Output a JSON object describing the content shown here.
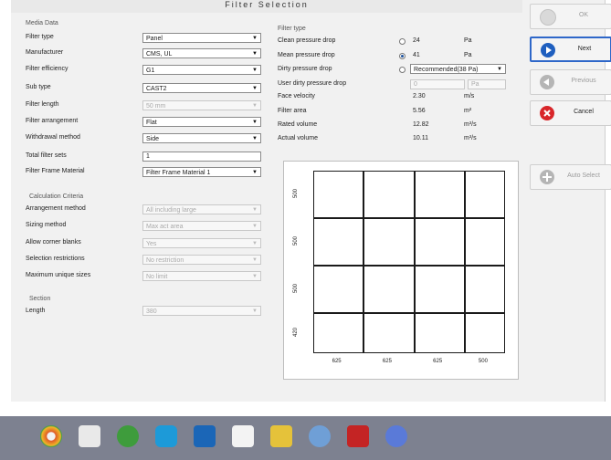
{
  "window_title": "Filter Selection",
  "media_data": {
    "group_label": "Media Data",
    "rows": [
      {
        "label": "Filter type",
        "value": "Panel",
        "kind": "combo",
        "enabled": true
      },
      {
        "label": "Manufacturer",
        "value": "CMS, UL",
        "kind": "combo",
        "enabled": true
      },
      {
        "label": "Filter efficiency",
        "value": "G1",
        "kind": "combo",
        "enabled": true
      },
      {
        "label": "Sub type",
        "value": "CAST2",
        "kind": "combo",
        "enabled": true
      },
      {
        "label": "Filter length",
        "value": "50 mm",
        "kind": "combo",
        "enabled": false
      },
      {
        "label": "Filter arrangement",
        "value": "Flat",
        "kind": "combo",
        "enabled": true
      },
      {
        "label": "Withdrawal method",
        "value": "Side",
        "kind": "combo",
        "enabled": true
      },
      {
        "label": "Total filter sets",
        "value": "1",
        "kind": "text",
        "enabled": true
      },
      {
        "label": "Filter Frame Material",
        "value": "Filter Frame Material 1",
        "kind": "combo",
        "enabled": true
      }
    ]
  },
  "calculation": {
    "group_label": "Calculation Criteria",
    "rows": [
      {
        "label": "Arrangement method",
        "value": "All including large"
      },
      {
        "label": "Sizing method",
        "value": "Max act area"
      },
      {
        "label": "Allow corner blanks",
        "value": "Yes"
      },
      {
        "label": "Selection restrictions",
        "value": "No restriction"
      },
      {
        "label": "Maximum unique sizes",
        "value": "No limit"
      }
    ]
  },
  "section": {
    "group_label": "Section",
    "length_label": "Length",
    "length_value": "380"
  },
  "filter_type": {
    "group_label": "Filter type",
    "clean_label": "Clean pressure drop",
    "clean_value": "24",
    "clean_unit": "Pa",
    "mean_label": "Mean pressure drop",
    "mean_value": "41",
    "mean_unit": "Pa",
    "dirty_label": "Dirty pressure drop",
    "dirty_option": "Recommended(38 Pa)",
    "user_label": "User dirty pressure drop",
    "user_value": "0",
    "user_unit": "Pa",
    "face_label": "Face velocity",
    "face_value": "2.30",
    "face_unit": "m/s",
    "area_label": "Filter area",
    "area_value": "5.56",
    "area_unit": "m²",
    "rated_label": "Rated volume",
    "rated_value": "12.82",
    "rated_unit": "m³/s",
    "actual_label": "Actual volume",
    "actual_value": "10.11",
    "actual_unit": "m³/s"
  },
  "buttons": {
    "ok": "OK",
    "next": "Next",
    "previous": "Previous",
    "cancel": "Cancel",
    "auto_select": "Auto Select"
  },
  "layout_preview": {
    "column_dims": [
      "625",
      "625",
      "625",
      "500"
    ],
    "row_dims": [
      "500",
      "500",
      "500",
      "420"
    ]
  },
  "colors": {
    "next_icon": "#1f5fbf",
    "cancel_icon": "#d8262a",
    "faded_icon": "#b5b5b5",
    "taskbar": "#7d8190"
  },
  "taskbar_icons": [
    "chrome-icon",
    "windows-store-icon",
    "utorrent-icon",
    "skype-icon",
    "outlook-icon",
    "pdf-reader-icon",
    "image-viewer-icon",
    "paint-icon",
    "adobe-acrobat-icon",
    "network-icon"
  ]
}
